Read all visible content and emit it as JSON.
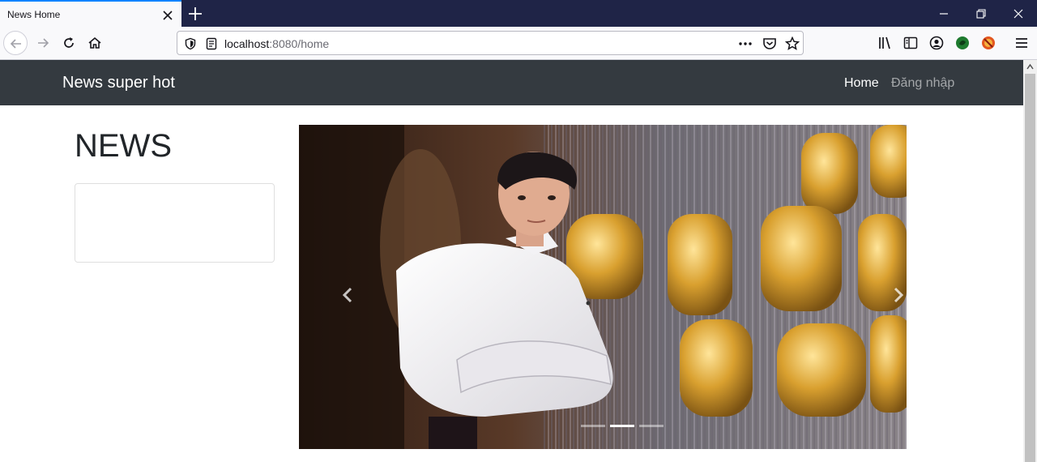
{
  "browser": {
    "tab_title": "News Home",
    "url_host": "localhost",
    "url_rest": ":8080/home"
  },
  "page": {
    "brand": "News super hot",
    "nav": {
      "home": "Home",
      "login": "Đăng nhập"
    },
    "heading": "NEWS"
  },
  "carousel": {
    "slide_count": 3,
    "active_index": 1
  },
  "colors": {
    "tab_strip": "#1f2447",
    "page_navbar": "#343a40",
    "accent": "#0a84ff"
  }
}
